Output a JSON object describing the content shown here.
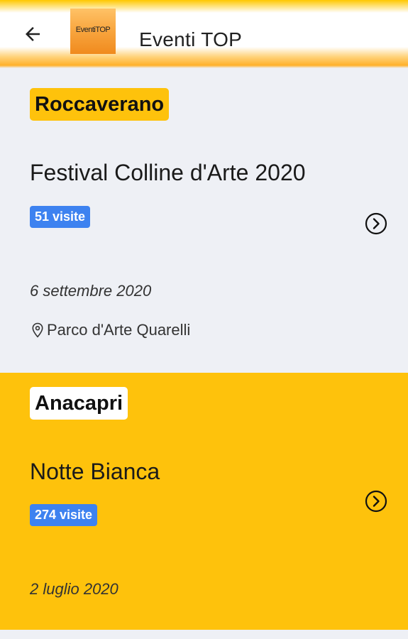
{
  "header": {
    "title": "Eventi TOP",
    "logo_text": "EventiTOP",
    "back_icon": "arrow-left-icon"
  },
  "colors": {
    "accent": "#fec20c",
    "badge_blue": "#3d82f0",
    "card_gray": "#eef0f5"
  },
  "events": [
    {
      "city": "Roccaverano",
      "title": "Festival Colline d'Arte 2020",
      "visits": "51 visite",
      "date": "6 settembre 2020",
      "location": "Parco d'Arte Quarelli",
      "icon": "chevron-right-circle-icon"
    },
    {
      "city": "Anacapri",
      "title": "Notte Bianca",
      "visits": "274 visite",
      "date": "2 luglio 2020",
      "icon": "chevron-right-circle-icon"
    }
  ]
}
